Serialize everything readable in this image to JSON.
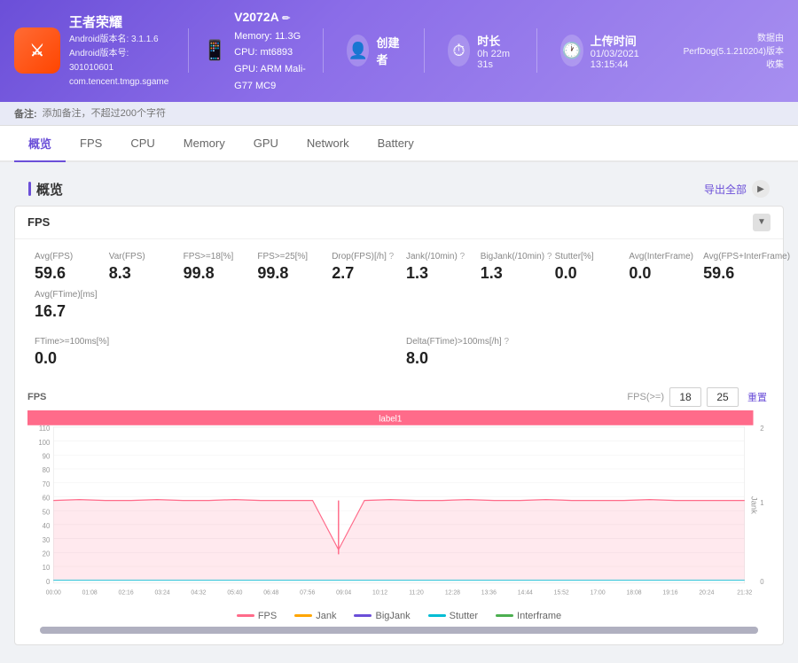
{
  "header": {
    "game_icon": "⚔",
    "game_title": "王者荣耀",
    "android_version": "Android版本名: 3.1.1.6",
    "android_code": "Android版本号: 301010601",
    "package": "com.tencent.tmgp.sgame",
    "device_name": "V2072A",
    "memory": "Memory: 11.3G",
    "cpu": "CPU: mt6893",
    "gpu": "GPU: ARM Mali-G77 MC9",
    "creator_label": "创建者",
    "creator_value": "",
    "duration_label": "时长",
    "duration_value": "0h 22m 31s",
    "upload_label": "上传时间",
    "upload_value": "01/03/2021 13:15:44",
    "source": "数据由PerfDog(5.1.210204)版本收集"
  },
  "note": {
    "label": "备注:",
    "placeholder": "添加备注，不超过200个字符"
  },
  "nav_tabs": [
    "概览",
    "FPS",
    "CPU",
    "Memory",
    "GPU",
    "Network",
    "Battery"
  ],
  "active_tab": "概览",
  "overview": {
    "title": "概览",
    "export_label": "导出全部"
  },
  "fps_section": {
    "title": "FPS",
    "stats": [
      {
        "label": "Avg(FPS)",
        "value": "59.6"
      },
      {
        "label": "Var(FPS)",
        "value": "8.3"
      },
      {
        "label": "FPS>=18[%]",
        "value": "99.8"
      },
      {
        "label": "FPS>=25[%]",
        "value": "99.8"
      },
      {
        "label": "Drop(FPS)[/h]",
        "value": "2.7",
        "has_q": true
      },
      {
        "label": "Jank(/10min)",
        "value": "1.3",
        "has_q": true
      },
      {
        "label": "BigJank(/10min)",
        "value": "1.3",
        "has_q": true
      },
      {
        "label": "Stutter[%]",
        "value": "0.0"
      },
      {
        "label": "Avg(InterFrame)",
        "value": "0.0"
      },
      {
        "label": "Avg(FPS+InterFrame)",
        "value": "59.6"
      },
      {
        "label": "Avg(FTime)[ms]",
        "value": "16.7"
      }
    ],
    "stats_row2": [
      {
        "label": "FTime>=100ms[%]",
        "value": "0.0"
      },
      {
        "label": "Delta(FTime)>100ms[/h]",
        "value": "8.0",
        "has_q": true
      }
    ],
    "chart": {
      "label": "FPS",
      "fps_threshold_label": "FPS(>=)",
      "fps_val1": "18",
      "fps_val2": "25",
      "reset_label": "重置",
      "bar_label": "label1",
      "x_labels": [
        "00:00",
        "01:08",
        "02:16",
        "03:24",
        "04:32",
        "05:40",
        "06:48",
        "07:56",
        "09:04",
        "10:12",
        "11:20",
        "12:28",
        "13:36",
        "14:44",
        "15:52",
        "17:00",
        "18:08",
        "19:16",
        "20:24",
        "21:32"
      ],
      "y_left_labels": [
        "110",
        "100",
        "90",
        "80",
        "70",
        "60",
        "50",
        "40",
        "30",
        "20",
        "10",
        "0"
      ],
      "y_right_labels": [
        "2",
        "1",
        "0"
      ],
      "legend": [
        {
          "label": "FPS",
          "color": "#ff6b8a"
        },
        {
          "label": "Jank",
          "color": "#ffa500"
        },
        {
          "label": "BigJank",
          "color": "#6b4fd8"
        },
        {
          "label": "Stutter",
          "color": "#00bcd4"
        },
        {
          "label": "Interframe",
          "color": "#4caf50"
        }
      ]
    }
  }
}
